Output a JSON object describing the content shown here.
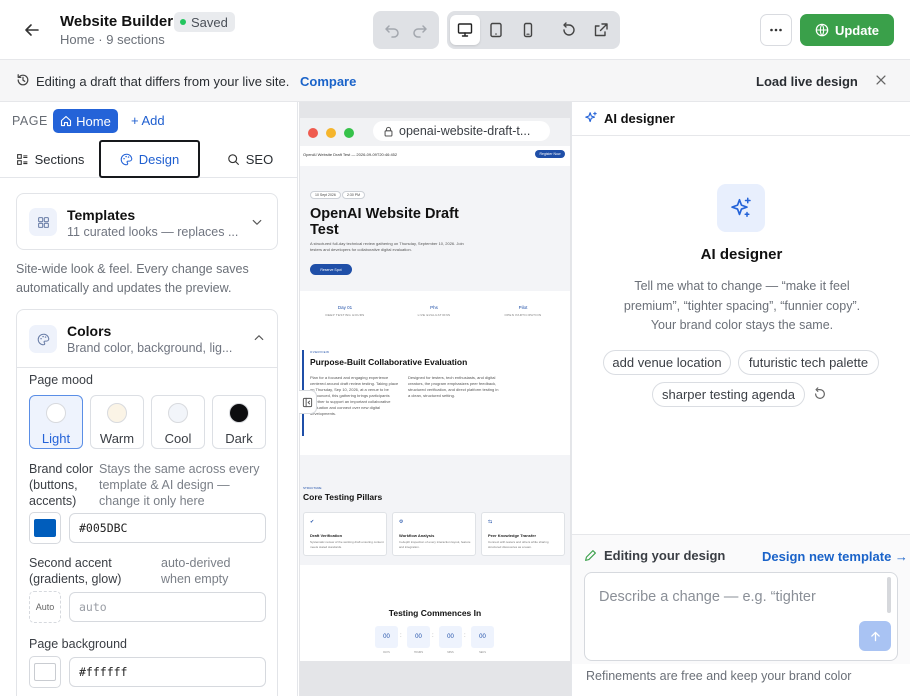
{
  "header": {
    "title": "Website Builder",
    "saved_label": "Saved",
    "subtitle": "Home · 9 sections",
    "update_label": "Update"
  },
  "banner": {
    "text": "Editing a draft that differs from your live site.",
    "compare_label": "Compare",
    "load_live_label": "Load live design"
  },
  "left": {
    "page_label": "PAGE",
    "home_label": "Home",
    "add_label": "+ Add",
    "tabs": [
      {
        "label": "Sections",
        "active": false
      },
      {
        "label": "Design",
        "active": true
      },
      {
        "label": "SEO",
        "active": false
      }
    ],
    "templates": {
      "title": "Templates",
      "subtitle": "11 curated looks — replaces ..."
    },
    "sitewide_text": "Site-wide look & feel. Every change saves automatically and updates the preview.",
    "colors": {
      "title": "Colors",
      "subtitle": "Brand color, background, lig...",
      "page_mood_label": "Page mood",
      "moods": [
        {
          "name": "Light",
          "color": "#ffffff",
          "active": true
        },
        {
          "name": "Warm",
          "color": "#fbf4e6",
          "active": false
        },
        {
          "name": "Cool",
          "color": "#f2f5fa",
          "active": false
        },
        {
          "name": "Dark",
          "color": "#0d0d0f",
          "active": false
        }
      ],
      "brand_label": "Brand color (buttons, accents)",
      "brand_help": "Stays the same across every template & AI design — change it only here",
      "brand_value": "#005DBC",
      "second_label": "Second accent (gradients, glow)",
      "second_help": "auto-derived when empty",
      "second_swatch": "Auto",
      "second_placeholder": "auto",
      "bg_label": "Page background",
      "bg_value": "#ffffff"
    }
  },
  "preview": {
    "url": "openai-website-draft-t...",
    "nav_text": "OpenAI Website Draft Test — 2026-09-09T20:46:452",
    "register_label": "Register Now",
    "chips": [
      "10 Sept 2026",
      "2:30 PM"
    ],
    "hero_title_line1": "OpenAI Website Draft",
    "hero_title_line2": "Test",
    "hero_desc": "A structured full-day technical review gathering on Thursday, September 10, 2026. Join testers and developers for collaborative digital evaluation.",
    "hero_cta": "Reserve Spot",
    "stats": [
      {
        "value": "Day 01",
        "label": "DEEP TESTING HOURS"
      },
      {
        "value": "Phs",
        "label": "LIVE EVALUATIONS"
      },
      {
        "value": "Pilot",
        "label": "OPEN PARTICIPATION"
      }
    ],
    "section_kicker": "OVERVIEW",
    "section_title": "Purpose-Built Collaborative Evaluation",
    "section_text_left": "Plan for a focused and engaging experience centered around draft review testing. Taking place on Thursday, Sep 10, 2026, at a venue to be announced, this gathering brings participants together to support an important collaborative evaluation and connect over new digital developments.",
    "section_text_right": "Designed for testers, tech enthusiasts, and digital creators, the program emphasizes peer feedback, structured verification, and direct platform testing in a clean, structured setting.",
    "pillars_kicker": "STRUCTURE",
    "pillars_title": "Core Testing Pillars",
    "pillars": [
      {
        "icon": "✔",
        "title": "Draft Verification",
        "text": "Systematic review of the working draft ensuring content meets stated standards."
      },
      {
        "icon": "⚙",
        "title": "Workflow Analysis",
        "text": "In-depth inspection of every interaction layout, feature and integration."
      },
      {
        "icon": "⇆",
        "title": "Peer Knowledge Transfer",
        "text": "Connect with testers and others while sharing structured discoveries as a team."
      }
    ],
    "countdown_title": "Testing Commences In",
    "countdown": [
      {
        "value": "00",
        "label": "DAYS"
      },
      {
        "value": "00",
        "label": "HOURS"
      },
      {
        "value": "00",
        "label": "MINS"
      },
      {
        "value": "00",
        "label": "SECS"
      }
    ]
  },
  "ai": {
    "header": "AI designer",
    "title": "AI designer",
    "description": "Tell me what to change — “make it feel premium”, “tighter spacing”, “funnier copy”. Your brand color stays the same.",
    "suggestions": [
      "add venue location",
      "futuristic tech palette",
      "sharper testing agenda"
    ],
    "editing_label": "Editing your design",
    "new_template_label": "Design new template →",
    "prompt_placeholder": "Describe a change — e.g. “tighter",
    "footnote": "Refinements are free and keep your brand color"
  },
  "colors": {
    "accent": "#2463d8",
    "update": "#3aa04a",
    "brand": "#005DBC"
  }
}
